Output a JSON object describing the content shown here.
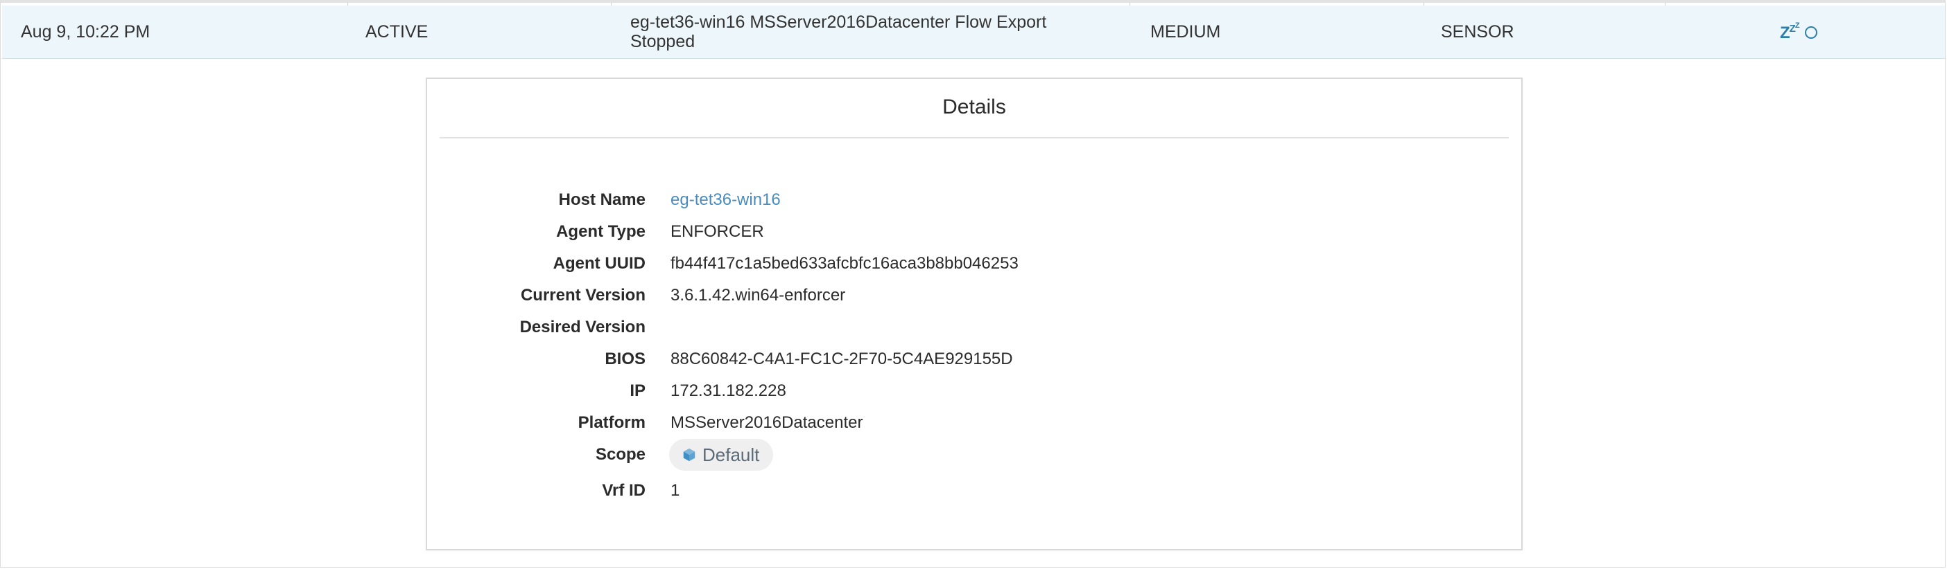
{
  "alert": {
    "time": "Aug 9, 10:22 PM",
    "status": "ACTIVE",
    "message": "eg-tet36-win16 MSServer2016Datacenter Flow Export Stopped",
    "severity": "MEDIUM",
    "type": "SENSOR",
    "actions": [
      {
        "icon": "snooze-icon"
      },
      {
        "icon": "circle-icon"
      }
    ]
  },
  "details": {
    "title": "Details",
    "fields": {
      "host_name": {
        "label": "Host Name",
        "value": "eg-tet36-win16"
      },
      "agent_type": {
        "label": "Agent Type",
        "value": "ENFORCER"
      },
      "agent_uuid": {
        "label": "Agent UUID",
        "value": "fb44f417c1a5bed633afcbfc16aca3b8bb046253"
      },
      "current_version": {
        "label": "Current Version",
        "value": "3.6.1.42.win64-enforcer"
      },
      "desired_version": {
        "label": "Desired Version",
        "value": ""
      },
      "bios": {
        "label": "BIOS",
        "value": "88C60842-C4A1-FC1C-2F70-5C4AE929155D"
      },
      "ip": {
        "label": "IP",
        "value": "172.31.182.228"
      },
      "platform": {
        "label": "Platform",
        "value": "MSServer2016Datacenter"
      },
      "scope": {
        "label": "Scope",
        "value": "Default",
        "icon": "cube-icon"
      },
      "vrf_id": {
        "label": "Vrf ID",
        "value": "1"
      }
    }
  },
  "colors": {
    "row_highlight": "#edf6fa",
    "link": "#4a8cbd",
    "accent": "#2d7ea8",
    "badge_bg": "#efefef"
  }
}
